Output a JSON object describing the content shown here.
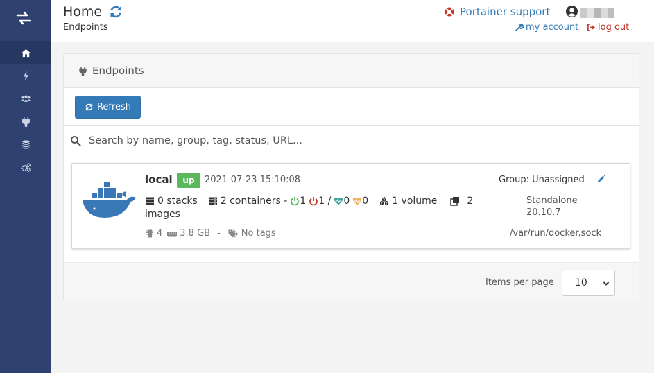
{
  "header": {
    "title": "Home",
    "breadcrumb": "Endpoints",
    "support_label": "Portainer support",
    "my_account_label": "my account",
    "logout_label": "log out"
  },
  "sidebar": {
    "items": [
      {
        "icon": "home-icon",
        "active": true
      },
      {
        "icon": "bolt-icon",
        "active": false
      },
      {
        "icon": "users-icon",
        "active": false
      },
      {
        "icon": "plug-icon",
        "active": false
      },
      {
        "icon": "database-icon",
        "active": false
      },
      {
        "icon": "cogs-icon",
        "active": false
      }
    ]
  },
  "widget": {
    "title": "Endpoints",
    "refresh_label": "Refresh",
    "search_placeholder": "Search by name, group, tag, status, URL..."
  },
  "endpoint": {
    "name": "local",
    "status": "up",
    "date": "2021-07-23 15:10:08",
    "group": "Group: Unassigned",
    "stacks": "0 stacks",
    "containers": "2 containers -",
    "running": "1",
    "stopped": "1 /",
    "healthy": "0",
    "unhealthy": "0",
    "volumes": "1 volume",
    "images_count": "2",
    "images_label": "images",
    "cpu": "4",
    "memory": "3.8 GB",
    "dash": "-",
    "tags": "No tags",
    "type": "Standalone",
    "version": "20.10.7",
    "url": "/var/run/docker.sock"
  },
  "pagination": {
    "items_per_page_label": "Items per page",
    "items_per_page_value": "10"
  },
  "colors": {
    "sidebar": "#2f4170",
    "primary": "#337ab7",
    "success": "#5cb85c",
    "danger": "#c0392b"
  }
}
